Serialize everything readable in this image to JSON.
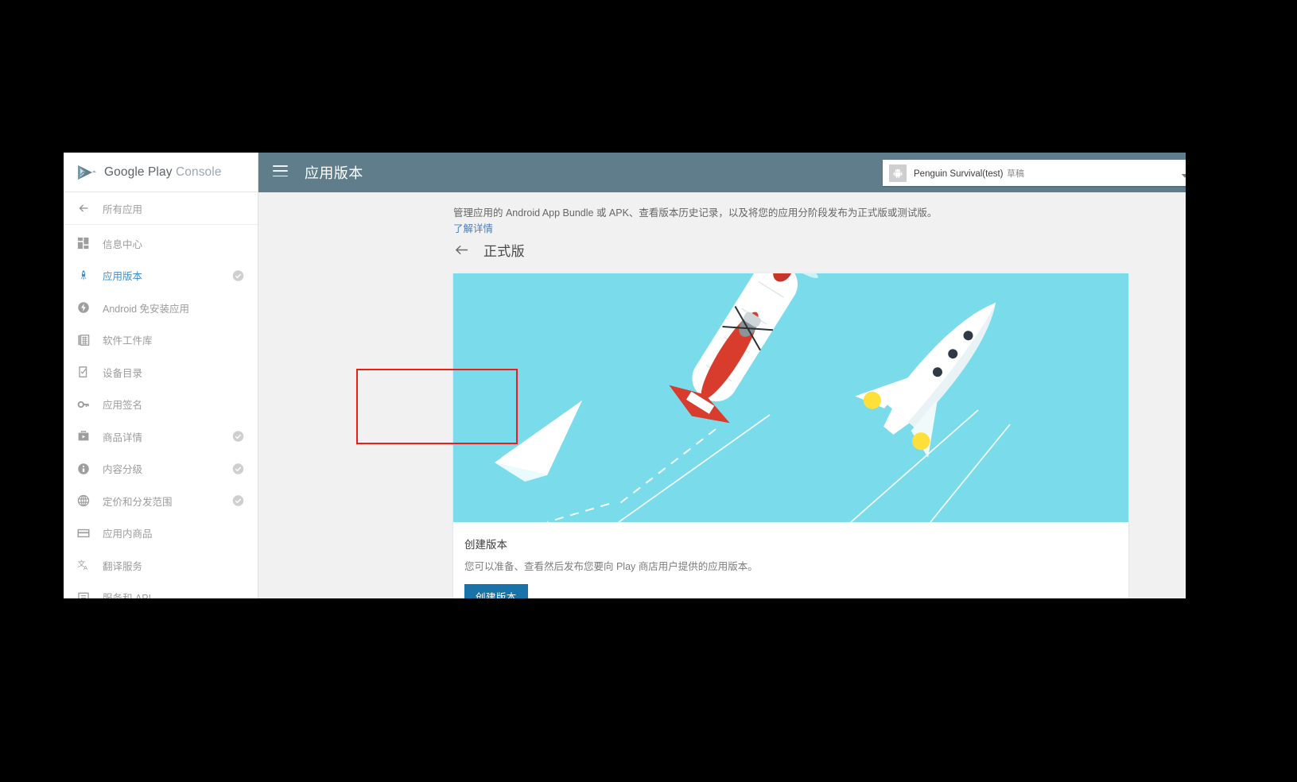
{
  "brand": {
    "name_1": "Google Play",
    "name_2": "Console",
    "logo_icon": "google-play-logo-icon"
  },
  "sidebar": {
    "back": {
      "label": "所有应用",
      "icon": "arrow-left-icon"
    },
    "items": [
      {
        "label": "信息中心",
        "icon": "dashboard-icon",
        "active": false,
        "check": false
      },
      {
        "label": "应用版本",
        "icon": "rocket-icon",
        "active": true,
        "check": true
      },
      {
        "label": "Android 免安装应用",
        "icon": "instant-apps-icon",
        "active": false,
        "check": false
      },
      {
        "label": "软件工件库",
        "icon": "artifact-library-icon",
        "active": false,
        "check": false
      },
      {
        "label": "设备目录",
        "icon": "device-catalog-icon",
        "active": false,
        "check": false
      },
      {
        "label": "应用签名",
        "icon": "key-icon",
        "active": false,
        "check": false
      },
      {
        "label": "商品详情",
        "icon": "store-listing-icon",
        "active": false,
        "check": true
      },
      {
        "label": "内容分级",
        "icon": "content-rating-icon",
        "active": false,
        "check": true
      },
      {
        "label": "定价和分发范围",
        "icon": "globe-icon",
        "active": false,
        "check": true
      },
      {
        "label": "应用内商品",
        "icon": "credit-card-icon",
        "active": false,
        "check": false
      },
      {
        "label": "翻译服务",
        "icon": "translate-icon",
        "active": false,
        "check": false
      },
      {
        "label": "服务和 API",
        "icon": "services-api-icon",
        "active": false,
        "check": false
      }
    ]
  },
  "topbar": {
    "menu_icon": "hamburger-menu-icon",
    "title": "应用版本",
    "app_selector": {
      "app_icon": "android-robot-icon",
      "app_name": "Penguin Survival(test)",
      "app_status": "草稿",
      "caret_icon": "chevron-down-icon"
    },
    "info_icon": "info-circle-icon",
    "background_color": "#607d8b"
  },
  "content": {
    "description": "管理应用的 Android App Bundle 或 APK、查看版本历史记录，以及将您的应用分阶段发布为正式版或测试版。",
    "learn_more": "了解详情",
    "page_back_icon": "arrow-left-icon",
    "page_title": "正式版",
    "card": {
      "hero_icons": [
        "paper-plane-icon",
        "biplane-icon",
        "rocket-icon"
      ],
      "hero_bg_color": "#7adcea",
      "heading": "创建版本",
      "body": "您可以准备、查看然后发布您要向 Play 商店用户提供的应用版本。",
      "button_label": "创建版本",
      "button_color": "#1a73a8"
    }
  },
  "annotation": {
    "name": "highlight-box",
    "color": "#f01c1c"
  }
}
